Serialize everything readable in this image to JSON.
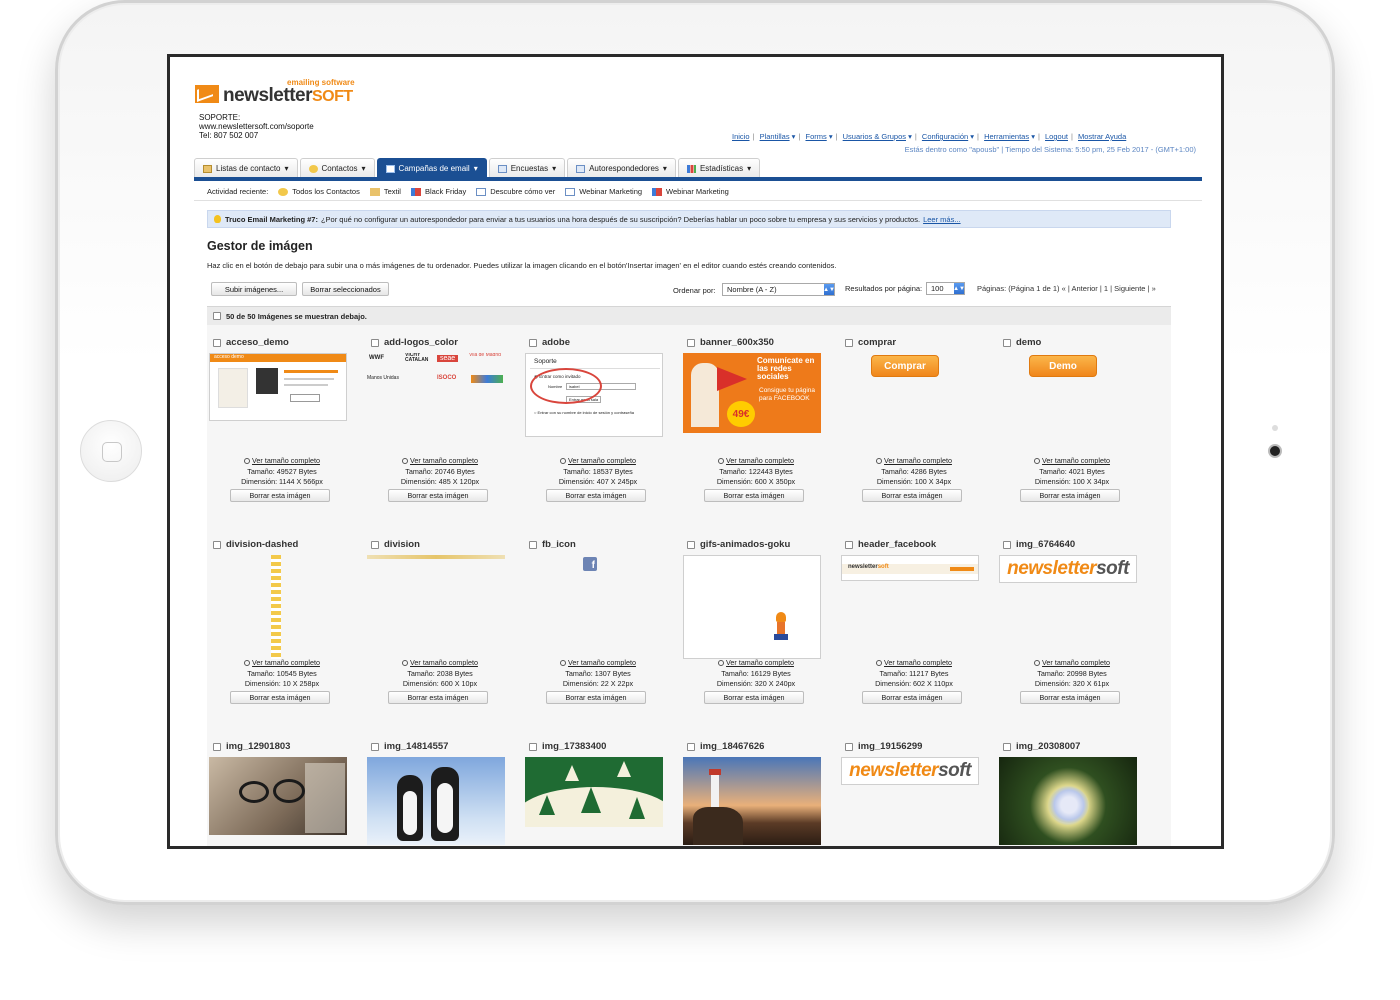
{
  "header": {
    "logo_tagline": "emailing software",
    "logo_word_main": "newsletter",
    "logo_word_soft": "SOFT",
    "support_lines": [
      "SOPORTE:",
      "www.newslettersoft.com/soporte",
      "Tel: 807 502 007"
    ]
  },
  "topnav": {
    "items": [
      "Inicio",
      "Plantillas",
      "Forms",
      "Usuarios & Grupos",
      "Configuración",
      "Herramientas",
      "Logout",
      "Mostrar Ayuda"
    ],
    "status": "Estás dentro como \"apousb\" | Tiempo del Sistema: 5:50 pm, 25 Feb 2017 - (GMT+1:00)"
  },
  "tabs": [
    {
      "label": "Listas de contacto",
      "icon": "list-icon"
    },
    {
      "label": "Contactos",
      "icon": "contacts-icon"
    },
    {
      "label": "Campañas de email",
      "icon": "email-icon"
    },
    {
      "label": "Encuestas",
      "icon": "survey-icon"
    },
    {
      "label": "Autorespondedores",
      "icon": "autoresponder-icon"
    },
    {
      "label": "Estadísticas",
      "icon": "stats-icon"
    }
  ],
  "recent": {
    "label": "Actividad reciente:",
    "items": [
      "Todos los Contactos",
      "Textil",
      "Black Friday",
      "Descubre cómo ver",
      "Webinar Marketing",
      "Webinar Marketing"
    ]
  },
  "tip": {
    "title": "Truco Email Marketing #7:",
    "text": "¿Por qué no configurar un autorespondedor para enviar a tus usuarios una hora después de su suscripción? Deberías hablar un poco sobre tu empresa y sus servicios y productos.",
    "more": "Leer más..."
  },
  "page": {
    "title": "Gestor de imágen",
    "description": "Haz clic en el botón de debajo para subir una o más imágenes de tu ordenador. Puedes utilizar la imagen clicando en el botón'Insertar imagen' en el editor cuando estés creando contenidos.",
    "upload_button": "Subir imágenes...",
    "delete_selected_button": "Borrar seleccionados",
    "order_label": "Ordenar por:",
    "order_value": "Nombre (A - Z)",
    "results_label": "Resultados por página:",
    "results_value": "100",
    "pagination": "Páginas: (Página 1 de 1)   « | Anterior | 1 | Siguiente | »",
    "list_summary": "50 de 50 Imágenes se muestran debajo."
  },
  "labels": {
    "view_full": "Ver tamaño completo",
    "delete": "Borrar esta imágen"
  },
  "images": [
    {
      "name": "acceso_demo",
      "size": "Tamaño: 49527 Bytes",
      "dim": "Dimensión: 1144 X 566px"
    },
    {
      "name": "add-logos_color",
      "size": "Tamaño: 20746 Bytes",
      "dim": "Dimensión: 485 X 120px"
    },
    {
      "name": "adobe",
      "size": "Tamaño: 18537 Bytes",
      "dim": "Dimensión: 407 X 245px"
    },
    {
      "name": "banner_600x350",
      "size": "Tamaño: 122443 Bytes",
      "dim": "Dimensión: 600 X 350px"
    },
    {
      "name": "comprar",
      "size": "Tamaño: 4286 Bytes",
      "dim": "Dimensión: 100 X 34px"
    },
    {
      "name": "demo",
      "size": "Tamaño: 4021 Bytes",
      "dim": "Dimensión: 100 X 34px"
    },
    {
      "name": "division-dashed",
      "size": "Tamaño: 10545 Bytes",
      "dim": "Dimensión: 10 X 258px"
    },
    {
      "name": "division",
      "size": "Tamaño: 2038 Bytes",
      "dim": "Dimensión: 600 X 10px"
    },
    {
      "name": "fb_icon",
      "size": "Tamaño: 1307 Bytes",
      "dim": "Dimensión: 22 X 22px"
    },
    {
      "name": "gifs-animados-goku",
      "size": "Tamaño: 16129 Bytes",
      "dim": "Dimensión: 320 X 240px"
    },
    {
      "name": "header_facebook",
      "size": "Tamaño: 11217 Bytes",
      "dim": "Dimensión: 602 X 110px"
    },
    {
      "name": "img_6764640",
      "size": "Tamaño: 20998 Bytes",
      "dim": "Dimensión: 320 X 61px"
    },
    {
      "name": "img_12901803",
      "size": "",
      "dim": ""
    },
    {
      "name": "img_14814557",
      "size": "",
      "dim": ""
    },
    {
      "name": "img_17383400",
      "size": "",
      "dim": ""
    },
    {
      "name": "img_18467626",
      "size": "",
      "dim": ""
    },
    {
      "name": "img_19156299",
      "size": "",
      "dim": ""
    },
    {
      "name": "img_20308007",
      "size": "",
      "dim": ""
    }
  ],
  "thumb_text": {
    "comprar": "Comprar",
    "demo": "Demo",
    "banner_main": "Comunícate en las redes sociales",
    "banner_sub": "Consigue tu página para FACEBOOK",
    "banner_price": "49€",
    "adobe_title": "Soporte",
    "adobe_opt1": "Entrar como invitado",
    "adobe_field_label": "Nombre",
    "adobe_field_value": "isabel",
    "adobe_enter": "Entrar en la sala",
    "adobe_opt2": "Entrar con su nombre de inicio de sesión y contraseña",
    "acceso_banner": "acceso demo",
    "logos": [
      "WWF",
      "VICHY CATALAN",
      "seae",
      "Vila de Madrid",
      "Manos Unidas",
      "ISOCO"
    ],
    "logo_word": "newsletter",
    "logo_soft": "soft"
  },
  "colors": {
    "brand_orange": "#f08a16",
    "nav_blue": "#1b4f93",
    "link_blue": "#1a56a6",
    "tip_bg": "#dfe9f7"
  }
}
